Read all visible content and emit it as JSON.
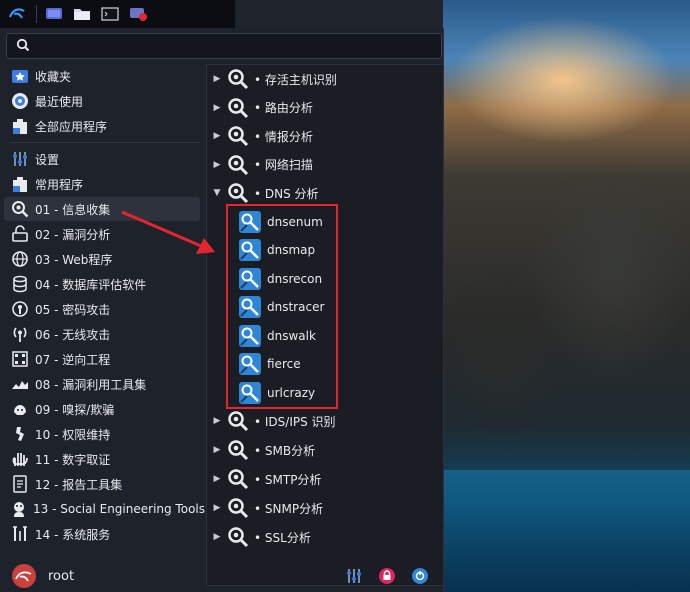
{
  "colors": {
    "accent": "#2f86d4",
    "highlight_box": "#e5262f",
    "menu_bg": "#1e222b"
  },
  "panel": {
    "icons": [
      "kali-menu-icon",
      "desktop-icon",
      "file-manager-icon",
      "terminal-icon",
      "screen-recorder-icon"
    ]
  },
  "search": {
    "value": "",
    "placeholder": ""
  },
  "sidebar": {
    "items": [
      {
        "label": "收藏夹",
        "icon": "star-folder-icon"
      },
      {
        "label": "最近使用",
        "icon": "recent-icon"
      },
      {
        "label": "全部应用程序",
        "icon": "all-apps-icon"
      },
      {
        "label": "设置",
        "icon": "settings-icon"
      },
      {
        "label": "常用程序",
        "icon": "common-apps-icon"
      },
      {
        "label": "01 - 信息收集",
        "icon": "info-gathering-icon"
      },
      {
        "label": "02 - 漏洞分析",
        "icon": "vuln-analysis-icon"
      },
      {
        "label": "03 - Web程序",
        "icon": "web-icon"
      },
      {
        "label": "04 - 数据库评估软件",
        "icon": "database-icon"
      },
      {
        "label": "05 - 密码攻击",
        "icon": "password-icon"
      },
      {
        "label": "06 - 无线攻击",
        "icon": "wireless-icon"
      },
      {
        "label": "07 - 逆向工程",
        "icon": "reverse-icon"
      },
      {
        "label": "08 - 漏洞利用工具集",
        "icon": "exploit-icon"
      },
      {
        "label": "09 - 嗅探/欺骗",
        "icon": "sniff-icon"
      },
      {
        "label": "10 - 权限维持",
        "icon": "persistence-icon"
      },
      {
        "label": "11 - 数字取证",
        "icon": "forensics-icon"
      },
      {
        "label": "12 - 报告工具集",
        "icon": "report-icon"
      },
      {
        "label": "13 - Social Engineering Tools",
        "icon": "social-eng-icon"
      },
      {
        "label": "14 - 系统服务",
        "icon": "services-icon"
      }
    ]
  },
  "submenu": {
    "groups": [
      {
        "label": "• 存活主机识别",
        "expanded": false
      },
      {
        "label": "• 路由分析",
        "expanded": false
      },
      {
        "label": "• 情报分析",
        "expanded": false
      },
      {
        "label": "• 网络扫描",
        "expanded": false
      },
      {
        "label": "• DNS 分析",
        "expanded": true
      },
      {
        "label": "• IDS/IPS 识别",
        "expanded": false
      },
      {
        "label": "• SMB分析",
        "expanded": false
      },
      {
        "label": "• SMTP分析",
        "expanded": false
      },
      {
        "label": "• SNMP分析",
        "expanded": false
      },
      {
        "label": "• SSL分析",
        "expanded": false
      }
    ],
    "tools": [
      "dnsenum",
      "dnsmap",
      "dnsrecon",
      "dnstracer",
      "dnswalk",
      "fierce",
      "urlcrazy"
    ]
  },
  "user": {
    "name": "root"
  },
  "bottom_icons": [
    "settings-manager-icon",
    "lock-screen-icon",
    "logout-icon"
  ]
}
